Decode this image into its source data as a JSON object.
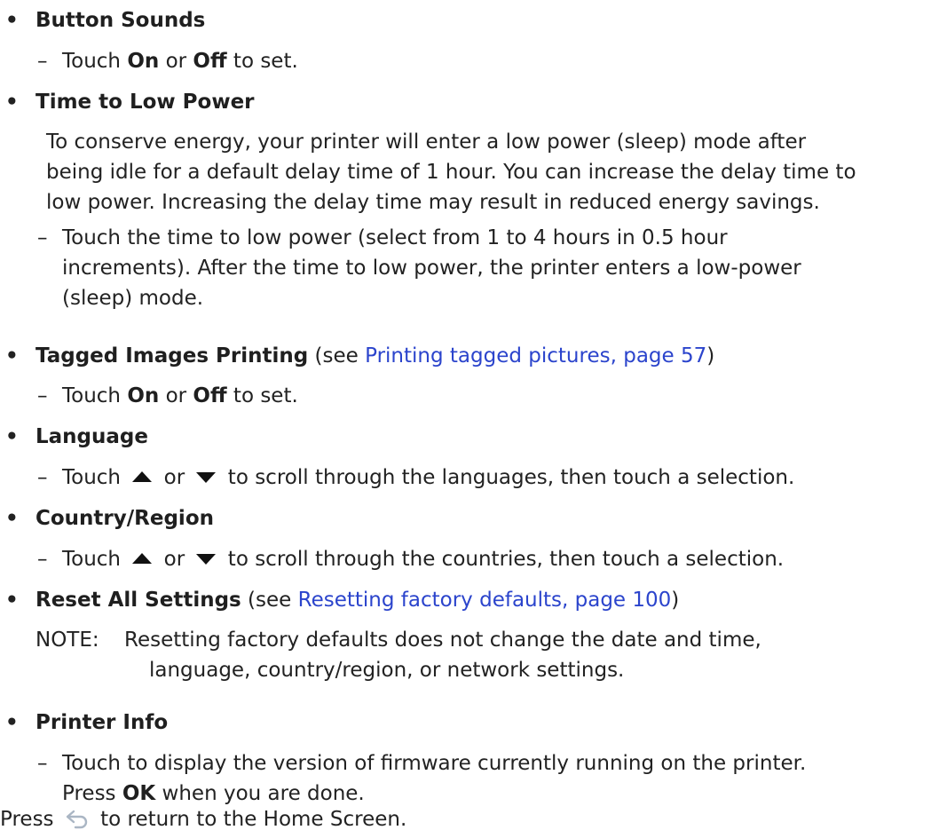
{
  "items": [
    {
      "title": "Button Sounds",
      "sub": {
        "pre": "Touch ",
        "b1": "On",
        "mid": " or ",
        "b2": "Off",
        "post": " to set."
      }
    },
    {
      "title": "Time to Low Power",
      "para": [
        "To conserve energy, your printer will enter a low power (sleep) mode after",
        "being idle for a default delay time of 1 hour. You can increase the delay time to",
        "low power. Increasing the delay time may result in reduced energy savings."
      ],
      "sub": [
        "Touch the time to low power (select from 1 to 4 hours in 0.5 hour",
        "increments). After the time to low power, the printer enters a low-power",
        "(sleep) mode."
      ]
    },
    {
      "title": "Tagged Images Printing",
      "pre_link": " (see ",
      "link": "Printing tagged pictures, page 57",
      "post_link": ")",
      "sub": {
        "pre": "Touch ",
        "b1": "On",
        "mid": " or ",
        "b2": "Off",
        "post": " to set."
      }
    },
    {
      "title": "Language",
      "sub": {
        "pre": "Touch ",
        "mid": " or ",
        "post": " to scroll through the languages, then touch a selection."
      }
    },
    {
      "title": "Country/Region",
      "sub": {
        "pre": "Touch ",
        "mid": " or ",
        "post": " to scroll through the countries, then touch a selection."
      }
    },
    {
      "title": "Reset All Settings",
      "pre_link": " (see ",
      "link": "Resetting factory defaults, page 100",
      "post_link": ")",
      "note_label": "NOTE:",
      "note": [
        "Resetting factory defaults does not change the date and time,",
        "language, country/region, or network settings."
      ]
    },
    {
      "title": "Printer Info",
      "sub": [
        "Touch to display the version of firmware currently running on the printer.",
        "Press ",
        "OK",
        " when you are done."
      ]
    }
  ],
  "bullet": "•",
  "dash": "–",
  "footer": {
    "pre": "Press ",
    "post": " to return to the Home Screen."
  },
  "icons": {
    "up": "triangle-up-icon",
    "down": "triangle-down-icon",
    "back": "back-arrow-icon"
  },
  "colors": {
    "link": "#2b44cc",
    "text": "#222222"
  }
}
